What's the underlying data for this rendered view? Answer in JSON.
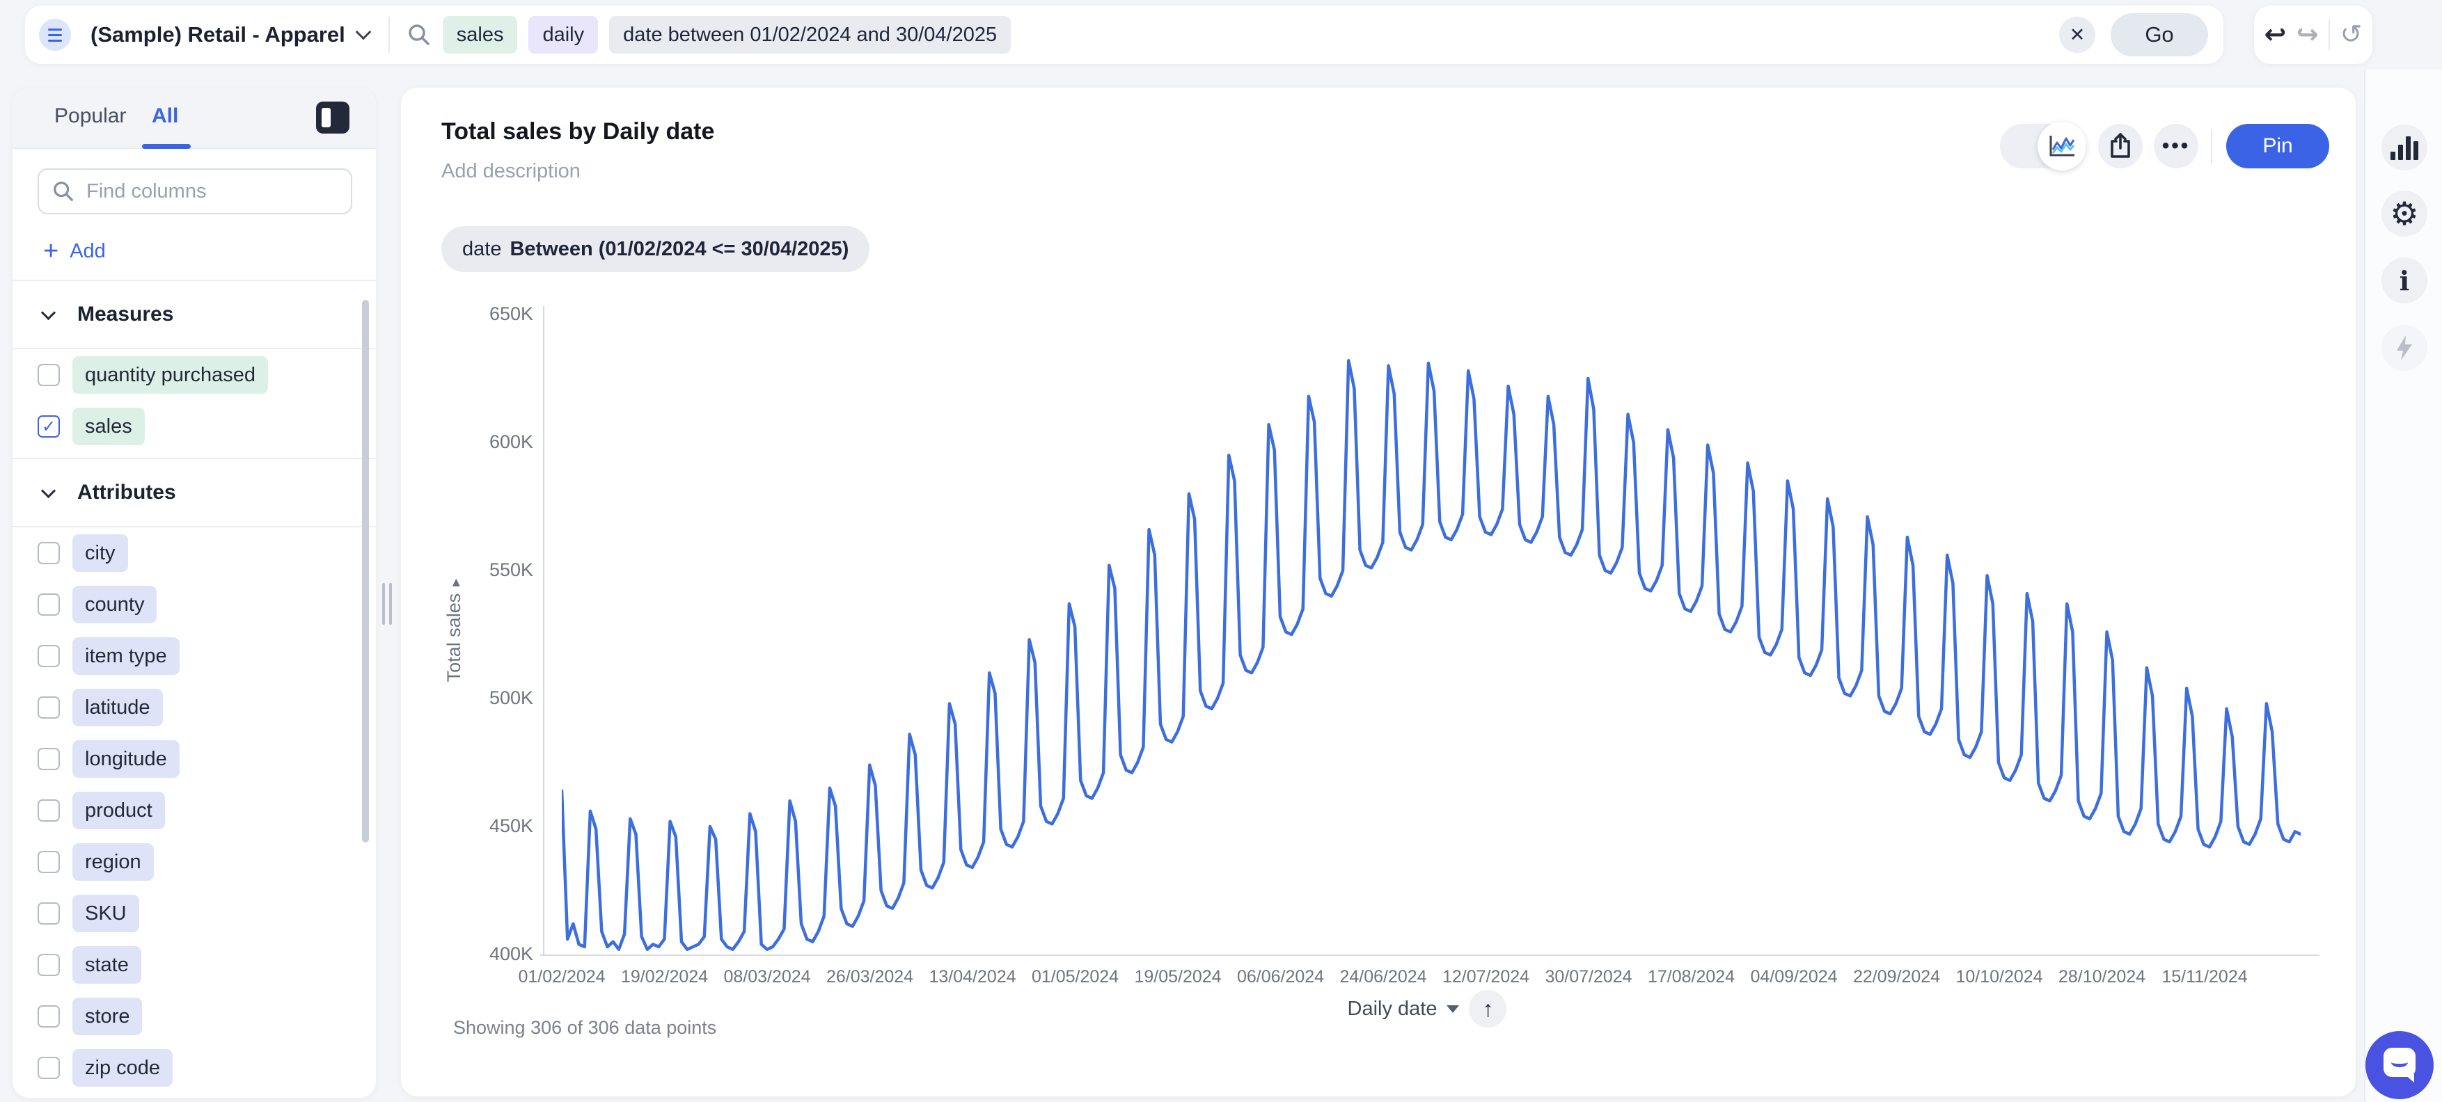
{
  "topbar": {
    "app_name": "(Sample) Retail - Apparel",
    "search_tokens": [
      {
        "text": "sales",
        "type": "measure"
      },
      {
        "text": "daily",
        "type": "keyword"
      },
      {
        "text": "date between 01/02/2024 and 30/04/2025",
        "type": "filter"
      }
    ],
    "go_label": "Go"
  },
  "sidebar": {
    "tabs": [
      {
        "label": "Popular",
        "active": false
      },
      {
        "label": "All",
        "active": true
      }
    ],
    "search_placeholder": "Find columns",
    "add_label": "Add",
    "sections": [
      {
        "title": "Measures",
        "items": [
          {
            "label": "quantity purchased",
            "checked": false
          },
          {
            "label": "sales",
            "checked": true
          }
        ]
      },
      {
        "title": "Attributes",
        "items": [
          {
            "label": "city",
            "checked": false
          },
          {
            "label": "county",
            "checked": false
          },
          {
            "label": "item type",
            "checked": false
          },
          {
            "label": "latitude",
            "checked": false
          },
          {
            "label": "longitude",
            "checked": false
          },
          {
            "label": "product",
            "checked": false
          },
          {
            "label": "region",
            "checked": false
          },
          {
            "label": "SKU",
            "checked": false
          },
          {
            "label": "state",
            "checked": false
          },
          {
            "label": "store",
            "checked": false
          },
          {
            "label": "zip code",
            "checked": false
          }
        ]
      }
    ]
  },
  "answer": {
    "title": "Total sales by Daily date",
    "description_placeholder": "Add description",
    "pin_label": "Pin",
    "filter_chip": {
      "prefix": "date",
      "condition": "Between (01/02/2024 <= 30/04/2025)"
    },
    "showing_text": "Showing 306 of 306 data points",
    "x_field_label": "Daily date"
  },
  "icons": {
    "undo": "↩",
    "redo": "↪",
    "reset": "↺",
    "close": "✕",
    "more": "•••",
    "sort_ascending": "↑",
    "gear": "⚙",
    "info": "i",
    "add_plus": "+",
    "y_axis_arrow": "▸"
  },
  "colors": {
    "accent_blue": "#3b63e6",
    "line_blue": "#3d6ede",
    "measure_token_bg": "#ddf0e7",
    "attribute_token_bg": "#dfe3f8",
    "keyword_token_bg": "#e9e5fa",
    "filter_token_bg": "#e9ebf1",
    "pin_bg": "#3b63e6",
    "chat_fab_bg": "#4a52e2"
  },
  "chart_data": {
    "type": "line",
    "title": "Total sales by Daily date",
    "xlabel": "Daily date",
    "ylabel": "Total sales",
    "legend": false,
    "grid": false,
    "num_points": 306,
    "start_date": "01/02/2024",
    "end_date_shown": "15/11/2024",
    "x_tick_labels": [
      "01/02/2024",
      "19/02/2024",
      "08/03/2024",
      "26/03/2024",
      "13/04/2024",
      "01/05/2024",
      "19/05/2024",
      "06/06/2024",
      "24/06/2024",
      "12/07/2024",
      "30/07/2024",
      "17/08/2024",
      "04/09/2024",
      "22/09/2024",
      "10/10/2024",
      "28/10/2024",
      "15/11/2024"
    ],
    "y_tick_labels": [
      "650K",
      "600K",
      "550K",
      "500K",
      "450K",
      "400K"
    ],
    "ylim": [
      400000,
      650000
    ],
    "value_unit": "thousands",
    "series": [
      {
        "name": "Total sales",
        "values_k": [
          464,
          406,
          412,
          404,
          403,
          456,
          449,
          409,
          403,
          405,
          402,
          408,
          453,
          447,
          407,
          402,
          404,
          403,
          406,
          452,
          446,
          405,
          402,
          403,
          404,
          407,
          450,
          445,
          406,
          403,
          402,
          405,
          409,
          455,
          448,
          404,
          402,
          403,
          406,
          410,
          460,
          452,
          412,
          406,
          405,
          409,
          415,
          465,
          458,
          418,
          412,
          411,
          415,
          421,
          474,
          466,
          425,
          419,
          418,
          422,
          428,
          486,
          478,
          433,
          427,
          426,
          430,
          436,
          498,
          490,
          441,
          435,
          434,
          438,
          444,
          510,
          502,
          449,
          443,
          442,
          446,
          452,
          523,
          514,
          458,
          452,
          451,
          455,
          461,
          537,
          528,
          468,
          462,
          461,
          465,
          471,
          552,
          543,
          478,
          472,
          471,
          475,
          481,
          566,
          556,
          490,
          484,
          483,
          487,
          493,
          580,
          570,
          503,
          497,
          496,
          500,
          506,
          595,
          585,
          517,
          511,
          510,
          514,
          520,
          607,
          597,
          532,
          526,
          525,
          529,
          535,
          618,
          608,
          547,
          541,
          540,
          544,
          550,
          632,
          621,
          558,
          552,
          551,
          555,
          561,
          630,
          619,
          565,
          559,
          558,
          562,
          568,
          631,
          620,
          569,
          563,
          562,
          566,
          572,
          628,
          617,
          571,
          565,
          564,
          568,
          574,
          622,
          611,
          568,
          562,
          561,
          565,
          571,
          618,
          607,
          563,
          557,
          556,
          560,
          566,
          625,
          613,
          556,
          550,
          549,
          553,
          559,
          611,
          600,
          549,
          543,
          542,
          546,
          552,
          605,
          594,
          541,
          535,
          534,
          538,
          544,
          599,
          588,
          533,
          527,
          526,
          530,
          536,
          592,
          581,
          524,
          518,
          517,
          521,
          527,
          585,
          574,
          516,
          510,
          509,
          513,
          519,
          578,
          567,
          508,
          502,
          501,
          505,
          511,
          571,
          560,
          501,
          495,
          494,
          498,
          504,
          563,
          552,
          493,
          487,
          486,
          490,
          496,
          556,
          545,
          484,
          478,
          477,
          481,
          487,
          548,
          537,
          475,
          469,
          468,
          472,
          478,
          541,
          530,
          467,
          461,
          460,
          464,
          470,
          537,
          526,
          460,
          454,
          453,
          457,
          463,
          526,
          515,
          454,
          448,
          447,
          451,
          457,
          512,
          501,
          451,
          445,
          444,
          448,
          454,
          504,
          493,
          449,
          443,
          442,
          446,
          452,
          496,
          485,
          450,
          444,
          443,
          447,
          453,
          498,
          487,
          451,
          445,
          444,
          448,
          447
        ]
      }
    ],
    "line_color": "#3d6ede"
  }
}
